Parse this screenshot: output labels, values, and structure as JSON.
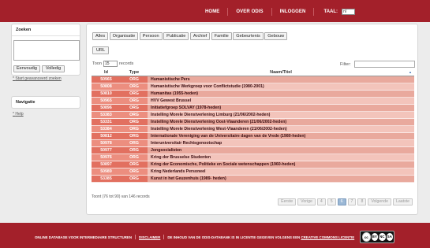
{
  "nav": {
    "items": [
      "HOME",
      "OVER ODIS",
      "INLOGGEN"
    ],
    "lang_label": "TAAL:",
    "lang_value": "nl"
  },
  "sidebar": {
    "search_title": "Zoeken",
    "simple_btn": "Eenvoudig",
    "full_btn": "Volledig",
    "adv_link": "Start geavanceerd zoeken",
    "nav_title": "Navigatie",
    "help_link": "Help"
  },
  "filters": [
    "Alles",
    "Organisatie",
    "Persoon",
    "Publicatie",
    "Archief",
    "Familie",
    "Gebeurtenis",
    "Gebouw"
  ],
  "url_btn": "URL",
  "table_controls": {
    "show_label": "Toon",
    "show_value": "15",
    "records_label": "records",
    "filter_label": "Filter:"
  },
  "table": {
    "columns": [
      "Id",
      "Type",
      "Naam/Titel"
    ],
    "rows": [
      {
        "id": "50965",
        "type": "ORG",
        "name": "Humanistische Pers"
      },
      {
        "id": "50808",
        "type": "ORG",
        "name": "Humanistische Werkgroep voor Conflictstudie (1980-2001)"
      },
      {
        "id": "50810",
        "type": "ORG",
        "name": "Humanitas (1955-heden)"
      },
      {
        "id": "50965",
        "type": "ORG",
        "name": "HVV Gewest Brussel"
      },
      {
        "id": "50896",
        "type": "ORG",
        "name": "Initiatiefgroep SOLVAY (1978-heden)"
      },
      {
        "id": "53383",
        "type": "ORG",
        "name": "Instelling Morele Dienstverlening Limburg (21/06/2002-heden)"
      },
      {
        "id": "53331",
        "type": "ORG",
        "name": "Instelling Morele Dienstverlening Oost-Vlaanderen (21/06/2002-heden)"
      },
      {
        "id": "53384",
        "type": "ORG",
        "name": "Instelling Morele Dienstverlening West-Vlaanderen (21/06/2002-heden)"
      },
      {
        "id": "50812",
        "type": "ORG",
        "name": "Internationale Vereniging van de Universitaire dagen van de Vrede (1980-heden)"
      },
      {
        "id": "50978",
        "type": "ORG",
        "name": "Interuniversitair Rechtsgenootschap"
      },
      {
        "id": "50977",
        "type": "ORG",
        "name": "Jongsocialisten"
      },
      {
        "id": "50976",
        "type": "ORG",
        "name": "Kring der Brusselse Studenten"
      },
      {
        "id": "50897",
        "type": "ORG",
        "name": "Kring der Economische, Politieke en Sociale wetenschappen (1960-heden)"
      },
      {
        "id": "50989",
        "type": "ORG",
        "name": "Kring Nederlands Personeel"
      },
      {
        "id": "53385",
        "type": "ORG",
        "name": "Kunst in het Geuzenhuis (1989- heden)"
      }
    ]
  },
  "info_text": "Toont (76 tot 90) van 146 records",
  "pager": {
    "first": "Eerste",
    "prev": "Vorige",
    "pages": [
      "4",
      "5",
      "6",
      "7",
      "8"
    ],
    "active_page": "6",
    "next": "Volgende",
    "last": "Laatste"
  },
  "footer": {
    "text1": "ONLINE DATABASE VOOR INTERMEDIAIRE STRUCTUREN",
    "disclaimer": "DISCLAIMER",
    "text2": "DE INHOUD VAN DE ODIS-DATABANK IS IN LICENTIE GEGEVEN VOLGENS EEN",
    "cc_link": "CREATIVE COMMONS LICENTIE",
    "cc_badge": [
      "cc",
      "BY",
      "NC",
      "SA"
    ]
  },
  "colors": {
    "brand_red": "#a3202a",
    "row_dark": "#e27060",
    "row_light": "#ec8e7f",
    "row_name_dark": "#e9a99d",
    "row_name_light": "#f3c4bb",
    "page_active": "#9bb8d6"
  }
}
